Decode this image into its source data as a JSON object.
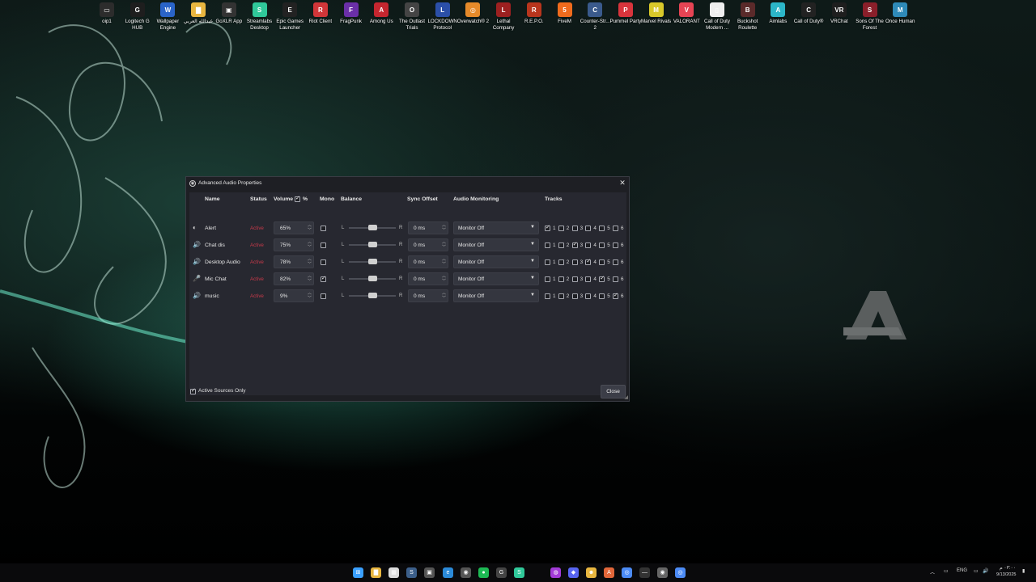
{
  "desktop_icons": [
    {
      "label": "oip1",
      "color": "#2c2c2c",
      "glyph": "▭"
    },
    {
      "label": "Logitech G HUB",
      "color": "#1e1e1e",
      "glyph": "G"
    },
    {
      "label": "Wallpaper Engine",
      "color": "#2a64c8",
      "glyph": "W"
    },
    {
      "label": "عبدالله العربي",
      "color": "#e8b640",
      "glyph": "▇"
    },
    {
      "label": "GoXLR App",
      "color": "#333",
      "glyph": "▣"
    },
    {
      "label": "Streamlabs Desktop",
      "color": "#30c89a",
      "glyph": "S"
    },
    {
      "label": "Epic Games Launcher",
      "color": "#222",
      "glyph": "E"
    },
    {
      "label": "Riot Client",
      "color": "#d13639",
      "glyph": "R"
    },
    {
      "label": "FragPunk",
      "color": "#6a2fa8",
      "glyph": "F"
    },
    {
      "label": "Among Us",
      "color": "#c5262f",
      "glyph": "A"
    },
    {
      "label": "The Outlast Trials",
      "color": "#444",
      "glyph": "O"
    },
    {
      "label": "LOCKDOWN Protocol",
      "color": "#2b4fa8",
      "glyph": "L"
    },
    {
      "label": "Overwatch® 2",
      "color": "#e58a2a",
      "glyph": "◎"
    },
    {
      "label": "Lethal Company",
      "color": "#9c2020",
      "glyph": "L"
    },
    {
      "label": "R.E.P.O.",
      "color": "#b8351d",
      "glyph": "R"
    },
    {
      "label": "FiveM",
      "color": "#f06b1d",
      "glyph": "5"
    },
    {
      "label": "Counter-Str... 2",
      "color": "#3a5a8c",
      "glyph": "C"
    },
    {
      "label": "Pummel Party",
      "color": "#d8343c",
      "glyph": "P"
    },
    {
      "label": "Marvel Rivals",
      "color": "#d9c92a",
      "glyph": "M"
    },
    {
      "label": "VALORANT",
      "color": "#e64454",
      "glyph": "V"
    },
    {
      "label": "Call of Duty Modern ...",
      "color": "#eee",
      "glyph": "▯"
    },
    {
      "label": "Buckshot Roulette",
      "color": "#5a2a2a",
      "glyph": "B"
    },
    {
      "label": "Aimlabs",
      "color": "#2cb6c8",
      "glyph": "A"
    },
    {
      "label": "Call of Duty®",
      "color": "#222",
      "glyph": "C"
    },
    {
      "label": "VRChat",
      "color": "#1e1e1e",
      "glyph": "VR"
    },
    {
      "label": "Sons Of The Forest",
      "color": "#8a1f2a",
      "glyph": "S"
    },
    {
      "label": "Once Human",
      "color": "#2e8ab8",
      "glyph": "M"
    }
  ],
  "dialog": {
    "title": "Advanced Audio Properties",
    "headers": {
      "name": "Name",
      "status": "Status",
      "volume": "Volume",
      "volume_unit": "%",
      "mono": "Mono",
      "balance": "Balance",
      "sync": "Sync Offset",
      "monitoring": "Audio Monitoring",
      "tracks": "Tracks"
    },
    "balance_left": "L",
    "balance_right": "R",
    "rows": [
      {
        "icon": "◐",
        "name": "Alert",
        "status": "Active",
        "volume": "65%",
        "mono": false,
        "balance": 0.5,
        "sync": "0 ms",
        "monitoring": "Monitor Off",
        "tracks": [
          true,
          false,
          false,
          false,
          false,
          false
        ]
      },
      {
        "icon": "🔊",
        "name": "Chat dis",
        "status": "Active",
        "volume": "75%",
        "mono": false,
        "balance": 0.5,
        "sync": "0 ms",
        "monitoring": "Monitor Off",
        "tracks": [
          false,
          false,
          true,
          false,
          false,
          false
        ]
      },
      {
        "icon": "🔊",
        "name": "Desktop Audio",
        "status": "Active",
        "volume": "78%",
        "mono": false,
        "balance": 0.5,
        "sync": "0 ms",
        "monitoring": "Monitor Off",
        "tracks": [
          false,
          false,
          false,
          true,
          false,
          false
        ]
      },
      {
        "icon": "🎤",
        "name": "Mic Chat",
        "status": "Active",
        "volume": "82%",
        "mono": true,
        "balance": 0.5,
        "sync": "0 ms",
        "monitoring": "Monitor Off",
        "tracks": [
          false,
          false,
          false,
          false,
          true,
          false
        ]
      },
      {
        "icon": "🔊",
        "name": "music",
        "status": "Active",
        "volume": "9%",
        "mono": false,
        "balance": 0.5,
        "sync": "0 ms",
        "monitoring": "Monitor Off",
        "tracks": [
          false,
          false,
          false,
          false,
          false,
          true
        ]
      }
    ],
    "track_numbers": [
      "1",
      "2",
      "3",
      "4",
      "5",
      "6"
    ],
    "active_sources_only": {
      "label": "Active Sources Only",
      "checked": true
    },
    "close_label": "Close"
  },
  "taskbar": {
    "apps": [
      {
        "name": "start",
        "glyph": "⊞",
        "color": "#3aa0ff"
      },
      {
        "name": "file-explorer",
        "glyph": "▇",
        "color": "#e8b640"
      },
      {
        "name": "calendar",
        "glyph": "▦",
        "color": "#ddd"
      },
      {
        "name": "steam",
        "glyph": "S",
        "color": "#3c5f8a"
      },
      {
        "name": "goxlr",
        "glyph": "▣",
        "color": "#555"
      },
      {
        "name": "edge",
        "glyph": "e",
        "color": "#2b8ad8"
      },
      {
        "name": "obs",
        "glyph": "◉",
        "color": "#555"
      },
      {
        "name": "spotify",
        "glyph": "●",
        "color": "#1db954"
      },
      {
        "name": "logitech",
        "glyph": "G",
        "color": "#444"
      },
      {
        "name": "streamlabs",
        "glyph": "S",
        "color": "#30c89a"
      },
      {
        "name": "messenger",
        "glyph": "◍",
        "color": "#a33bd8"
      },
      {
        "name": "discord",
        "glyph": "◆",
        "color": "#5865f2"
      },
      {
        "name": "smile",
        "glyph": "☻",
        "color": "#e8b640"
      },
      {
        "name": "brave",
        "glyph": "A",
        "color": "#e2673a"
      },
      {
        "name": "chrome",
        "glyph": "◎",
        "color": "#4c8bf5"
      },
      {
        "name": "dash",
        "glyph": "—",
        "color": "#333"
      },
      {
        "name": "obs-recording",
        "glyph": "◉",
        "color": "#666"
      },
      {
        "name": "chrome-2",
        "glyph": "◎",
        "color": "#4c8bf5"
      }
    ],
    "tray": {
      "lang": "ENG",
      "time": "٠٣:٠٠ م",
      "date": "9/13/2025"
    }
  }
}
